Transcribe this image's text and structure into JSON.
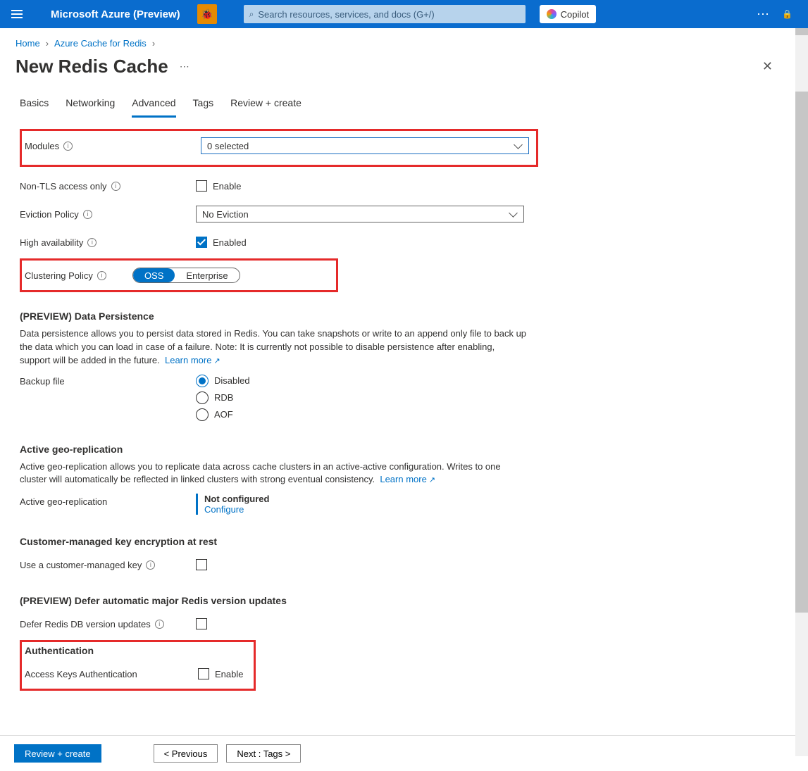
{
  "topbar": {
    "brand": "Microsoft Azure (Preview)",
    "search_placeholder": "Search resources, services, and docs (G+/)",
    "copilot_label": "Copilot"
  },
  "breadcrumb": {
    "home": "Home",
    "service": "Azure Cache for Redis"
  },
  "page": {
    "title": "New Redis Cache"
  },
  "tabs": {
    "basics": "Basics",
    "networking": "Networking",
    "advanced": "Advanced",
    "tags": "Tags",
    "review": "Review + create"
  },
  "form": {
    "modules_label": "Modules",
    "modules_value": "0 selected",
    "nontls_label": "Non-TLS access only",
    "nontls_enable": "Enable",
    "eviction_label": "Eviction Policy",
    "eviction_value": "No Eviction",
    "ha_label": "High availability",
    "ha_value": "Enabled",
    "clustering_label": "Clustering Policy",
    "clustering_oss": "OSS",
    "clustering_ent": "Enterprise"
  },
  "persistence": {
    "heading": "(PREVIEW) Data Persistence",
    "desc": "Data persistence allows you to persist data stored in Redis. You can take snapshots or write to an append only file to back up the data which you can load in case of a failure. Note: It is currently not possible to disable persistence after enabling, support will be added in the future.",
    "learn": "Learn more",
    "backup_label": "Backup file",
    "opt_disabled": "Disabled",
    "opt_rdb": "RDB",
    "opt_aof": "AOF"
  },
  "geo": {
    "heading": "Active geo-replication",
    "desc": "Active geo-replication allows you to replicate data across cache clusters in an active-active configuration. Writes to one cluster will automatically be reflected in linked clusters with strong eventual consistency.",
    "learn": "Learn more",
    "label": "Active geo-replication",
    "not_configured": "Not configured",
    "configure": "Configure"
  },
  "cmk": {
    "heading": "Customer-managed key encryption at rest",
    "label": "Use a customer-managed key"
  },
  "defer": {
    "heading": "(PREVIEW) Defer automatic major Redis version updates",
    "label": "Defer Redis DB version updates"
  },
  "auth": {
    "heading": "Authentication",
    "label": "Access Keys Authentication",
    "enable": "Enable"
  },
  "footer": {
    "review": "Review + create",
    "prev": "< Previous",
    "next": "Next : Tags >"
  }
}
